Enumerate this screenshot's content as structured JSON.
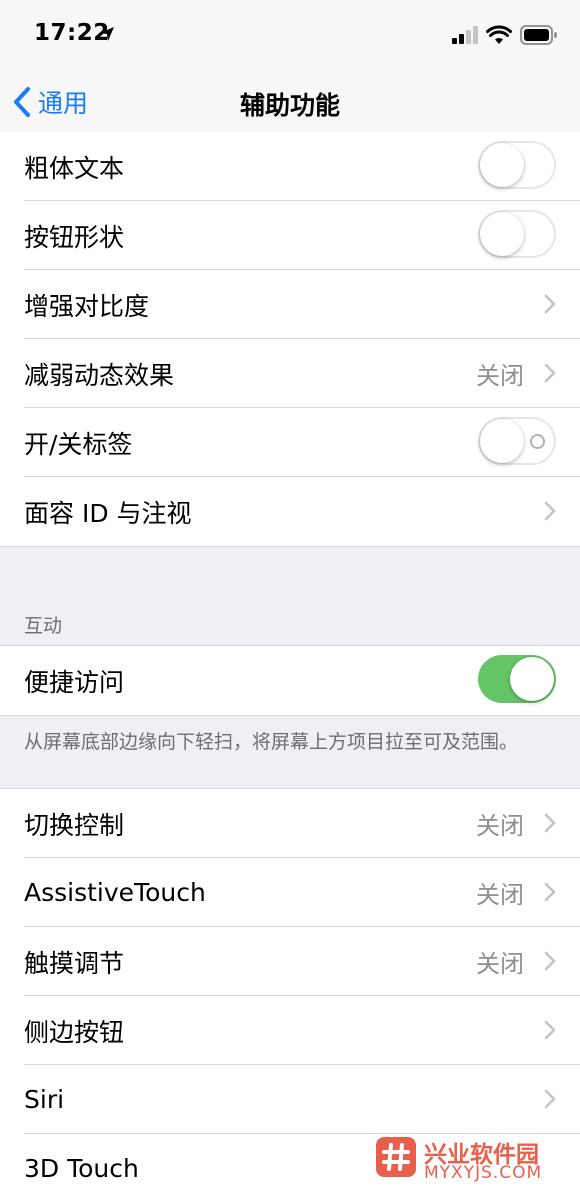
{
  "status_bar": {
    "time": "17:22"
  },
  "nav": {
    "back_label": "通用",
    "title": "辅助功能"
  },
  "group_vision": [
    {
      "label": "粗体文本",
      "control": "toggle",
      "on": false
    },
    {
      "label": "按钮形状",
      "control": "toggle",
      "on": false
    },
    {
      "label": "增强对比度",
      "control": "chevron"
    },
    {
      "label": "减弱动态效果",
      "value": "关闭",
      "control": "chevron"
    },
    {
      "label": "开/关标签",
      "control": "toggle",
      "on": false
    },
    {
      "label": "面容 ID 与注视",
      "control": "chevron"
    }
  ],
  "section_interaction": {
    "header": "互动",
    "reachability": {
      "label": "便捷访问",
      "on": true
    },
    "footer": "从屏幕底部边缘向下轻扫，将屏幕上方项目拉至可及范围。"
  },
  "group_interaction": [
    {
      "label": "切换控制",
      "value": "关闭"
    },
    {
      "label": "AssistiveTouch",
      "value": "关闭"
    },
    {
      "label": "触摸调节",
      "value": "关闭"
    },
    {
      "label": "侧边按钮"
    },
    {
      "label": "Siri"
    },
    {
      "label": "3D Touch"
    }
  ],
  "watermark": {
    "title": "兴业软件园",
    "subtitle": "MYXYJS.COM"
  },
  "colors": {
    "accent": "#1a7cf5",
    "toggle_on": "#65c466",
    "secondary_text": "#8e8e93",
    "watermark": "#e8604c"
  },
  "icons": {
    "back": "chevron-left-icon",
    "row_disclosure": "chevron-right-icon",
    "location": "location-arrow-icon",
    "signal": "cellular-signal-icon",
    "wifi": "wifi-icon",
    "battery": "battery-icon"
  }
}
